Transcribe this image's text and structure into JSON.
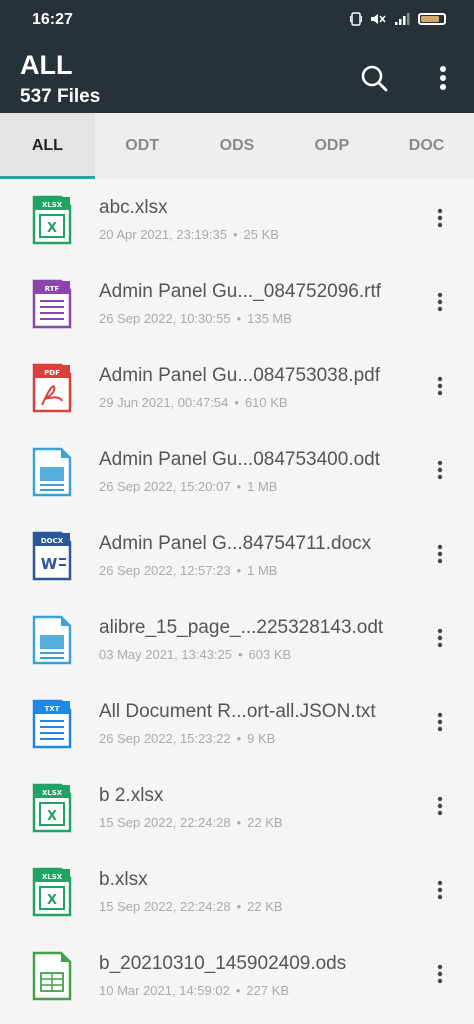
{
  "status": {
    "time": "16:27",
    "battery_level": 0.8
  },
  "header": {
    "title": "ALL",
    "subtitle": "537 Files"
  },
  "colors": {
    "appbar": "#263238",
    "tab_indicator": "#26a69a"
  },
  "tabs": [
    {
      "label": "ALL",
      "active": true
    },
    {
      "label": "ODT",
      "active": false
    },
    {
      "label": "ODS",
      "active": false
    },
    {
      "label": "ODP",
      "active": false
    },
    {
      "label": "DOC",
      "active": false
    }
  ],
  "files": [
    {
      "name": "abc.xlsx",
      "date": "20 Apr 2021, 23:19:35",
      "size": "25 KB",
      "icon": "xlsx-icon",
      "badge": "XLSX",
      "color": "#21a366"
    },
    {
      "name": "Admin Panel Gu..._084752096.rtf",
      "date": "26 Sep 2022, 10:30:55",
      "size": "135 MB",
      "icon": "rtf-icon",
      "badge": "RTF",
      "color": "#8e44ad"
    },
    {
      "name": "Admin Panel Gu...084753038.pdf",
      "date": "29 Jun 2021, 00:47:54",
      "size": "610 KB",
      "icon": "pdf-icon",
      "badge": "PDF",
      "color": "#d9413a"
    },
    {
      "name": "Admin Panel Gu...084753400.odt",
      "date": "26 Sep 2022, 15:20:07",
      "size": "1 MB",
      "icon": "odt-icon",
      "badge": "",
      "color": "#3aa1d8"
    },
    {
      "name": "Admin Panel G...84754711.docx",
      "date": "26 Sep 2022, 12:57:23",
      "size": "1 MB",
      "icon": "docx-icon",
      "badge": "DOCX",
      "color": "#2b579a"
    },
    {
      "name": "alibre_15_page_...225328143.odt",
      "date": "03 May 2021, 13:43:25",
      "size": "603 KB",
      "icon": "odt-icon",
      "badge": "",
      "color": "#3aa1d8"
    },
    {
      "name": "All Document R...ort-all.JSON.txt",
      "date": "26 Sep 2022, 15:23:22",
      "size": "9 KB",
      "icon": "txt-icon",
      "badge": "TXT",
      "color": "#1e88e5"
    },
    {
      "name": "b 2.xlsx",
      "date": "15 Sep 2022, 22:24:28",
      "size": "22 KB",
      "icon": "xlsx-icon",
      "badge": "XLSX",
      "color": "#21a366"
    },
    {
      "name": "b.xlsx",
      "date": "15 Sep 2022, 22:24:28",
      "size": "22 KB",
      "icon": "xlsx-icon",
      "badge": "XLSX",
      "color": "#21a366"
    },
    {
      "name": "b_20210310_145902409.ods",
      "date": "10 Mar 2021, 14:59:02",
      "size": "227 KB",
      "icon": "ods-icon",
      "badge": "",
      "color": "#43a047"
    }
  ]
}
